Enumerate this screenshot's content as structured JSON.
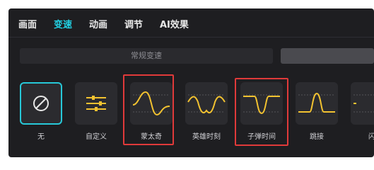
{
  "tabs": [
    {
      "label": "画面",
      "active": false
    },
    {
      "label": "变速",
      "active": true
    },
    {
      "label": "动画",
      "active": false
    },
    {
      "label": "调节",
      "active": false
    },
    {
      "label": "AI效果",
      "active": false
    }
  ],
  "speed_mode": {
    "normal_label": "常规变速",
    "curve_label": ""
  },
  "presets": [
    {
      "label": "无",
      "icon": "none-icon",
      "selected": true
    },
    {
      "label": "自定义",
      "icon": "custom-sliders-icon",
      "selected": false
    },
    {
      "label": "蒙太奇",
      "icon": "montage-curve-icon",
      "selected": false
    },
    {
      "label": "英雄时刻",
      "icon": "hero-moment-curve-icon",
      "selected": false
    },
    {
      "label": "子弹时间",
      "icon": "bullet-time-curve-icon",
      "selected": false
    },
    {
      "label": "跳接",
      "icon": "jump-cut-curve-icon",
      "selected": false
    },
    {
      "label": "闪",
      "icon": "flash-curve-icon",
      "selected": false
    }
  ],
  "colors": {
    "accent": "#22d3e6",
    "curve": "#f2c230",
    "highlight": "#e03a3a",
    "panel": "#1e1e21",
    "tile": "#2b2b2f"
  }
}
